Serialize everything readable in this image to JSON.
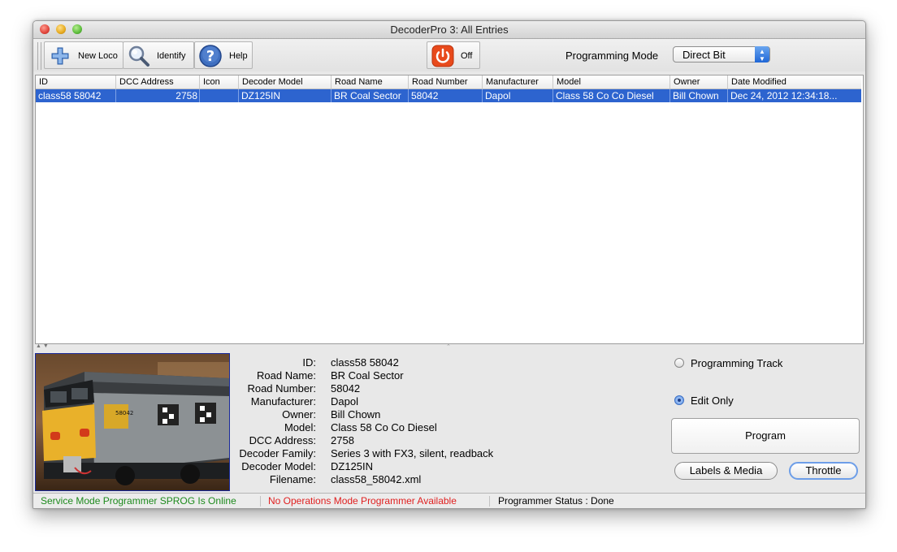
{
  "window": {
    "title": "DecoderPro 3: All Entries"
  },
  "toolbar": {
    "new_loco": "New Loco",
    "identify": "Identify",
    "help": "Help",
    "power": "Off",
    "programming_mode_label": "Programming Mode",
    "programming_mode_value": "Direct Bit"
  },
  "table": {
    "columns": [
      "ID",
      "DCC Address",
      "Icon",
      "Decoder Model",
      "Road Name",
      "Road Number",
      "Manufacturer",
      "Model",
      "Owner",
      "Date Modified"
    ],
    "rows": [
      {
        "id": "class58 58042",
        "dcc_address": "2758",
        "icon": "",
        "decoder_model": "DZ125IN",
        "road_name": "BR Coal Sector",
        "road_number": "58042",
        "manufacturer": "Dapol",
        "model": "Class 58 Co Co Diesel",
        "owner": "Bill Chown",
        "date_modified": "Dec 24, 2012 12:34:18..."
      }
    ]
  },
  "details": {
    "labels": [
      "ID:",
      "Road Name:",
      "Road Number:",
      "Manufacturer:",
      "Owner:",
      "Model:",
      "DCC Address:",
      "Decoder Family:",
      "Decoder Model:",
      "Filename:"
    ],
    "values": [
      "class58 58042",
      "BR Coal Sector",
      "58042",
      "Dapol",
      "Bill Chown",
      "Class 58 Co Co Diesel",
      "2758",
      "Series 3 with FX3, silent, readback",
      "DZ125IN",
      "class58_58042.xml"
    ]
  },
  "side": {
    "programming_track": "Programming Track",
    "edit_only": "Edit Only",
    "selected": "Edit Only",
    "program": "Program",
    "labels_media": "Labels & Media",
    "throttle": "Throttle"
  },
  "status": {
    "service": "Service Mode Programmer SPROG Is Online",
    "operations": "No Operations Mode Programmer Available",
    "programmer_status": "Programmer Status :  Done"
  },
  "colors": {
    "selection": "#2d64cf",
    "status_ok": "#1d8a1d",
    "status_err": "#e02020",
    "power_off": "#e84a1c"
  }
}
